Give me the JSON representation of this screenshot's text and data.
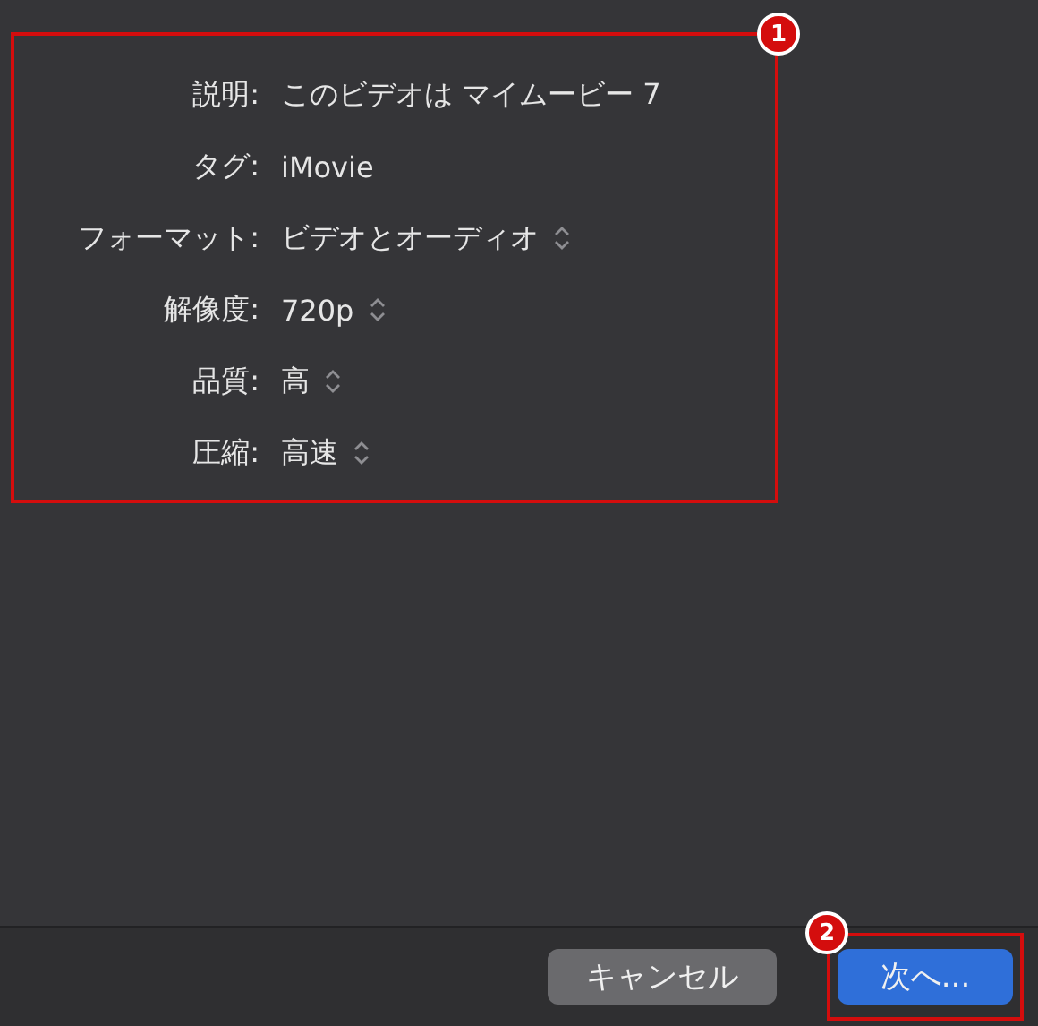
{
  "annotations": [
    {
      "number": "1"
    },
    {
      "number": "2"
    }
  ],
  "fields": [
    {
      "label": "説明:",
      "value": "このビデオは マイムービー 7",
      "kind": "text"
    },
    {
      "label": "タグ:",
      "value": "iMovie",
      "kind": "text"
    },
    {
      "label": "フォーマット:",
      "value": "ビデオとオーディオ",
      "kind": "popup"
    },
    {
      "label": "解像度:",
      "value": "720p",
      "kind": "popup"
    },
    {
      "label": "品質:",
      "value": "高",
      "kind": "popup"
    },
    {
      "label": "圧縮:",
      "value": "高速",
      "kind": "popup"
    }
  ],
  "buttons": [
    {
      "label": "キャンセル",
      "kind": "secondary"
    },
    {
      "label": "次へ...",
      "kind": "primary"
    }
  ]
}
